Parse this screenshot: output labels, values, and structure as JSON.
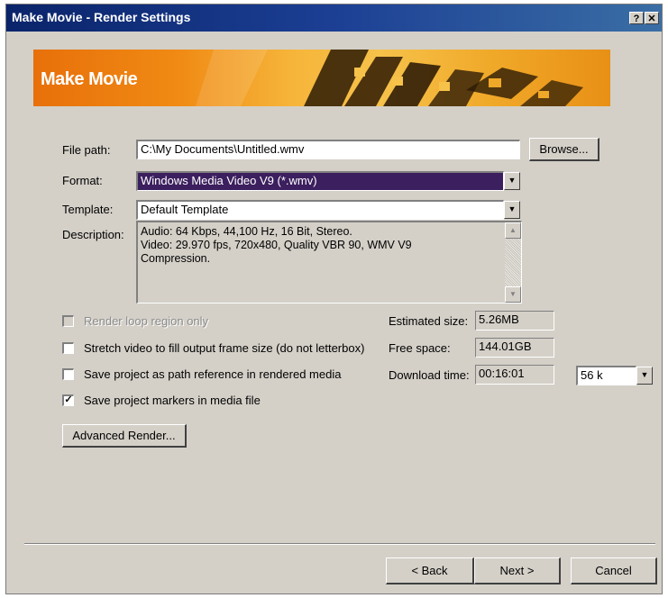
{
  "window": {
    "title": "Make Movie - Render Settings",
    "help_label": "?",
    "close_label": "✕"
  },
  "banner": {
    "title": "Make Movie"
  },
  "form": {
    "file_path": {
      "label": "File path:",
      "value": "C:\\My Documents\\Untitled.wmv"
    },
    "browse_label": "Browse...",
    "format": {
      "label": "Format:",
      "value": "Windows Media Video V9 (*.wmv)"
    },
    "template": {
      "label": "Template:",
      "value": "Default Template"
    },
    "description": {
      "label": "Description:",
      "line1": "Audio: 64 Kbps, 44,100 Hz, 16 Bit, Stereo.",
      "line2": "Video: 29.970 fps, 720x480, Quality VBR 90, WMV V9",
      "line3": "Compression."
    }
  },
  "options": [
    {
      "label": "Render loop region only",
      "checked": false,
      "disabled": true
    },
    {
      "label": "Stretch video to fill output frame size (do not letterbox)",
      "checked": false,
      "disabled": false
    },
    {
      "label": "Save project as path reference in rendered media",
      "checked": false,
      "disabled": false
    },
    {
      "label": "Save project markers in media file",
      "checked": true,
      "disabled": false
    }
  ],
  "stats": {
    "estimated_size": {
      "label": "Estimated size:",
      "value": "5.26MB"
    },
    "free_space": {
      "label": "Free space:",
      "value": "144.01GB"
    },
    "download_time": {
      "label": "Download time:",
      "value": "00:16:01"
    },
    "connection": "56 k"
  },
  "buttons": {
    "advanced": "Advanced Render...",
    "back": "< Back",
    "next": "Next >",
    "cancel": "Cancel"
  }
}
